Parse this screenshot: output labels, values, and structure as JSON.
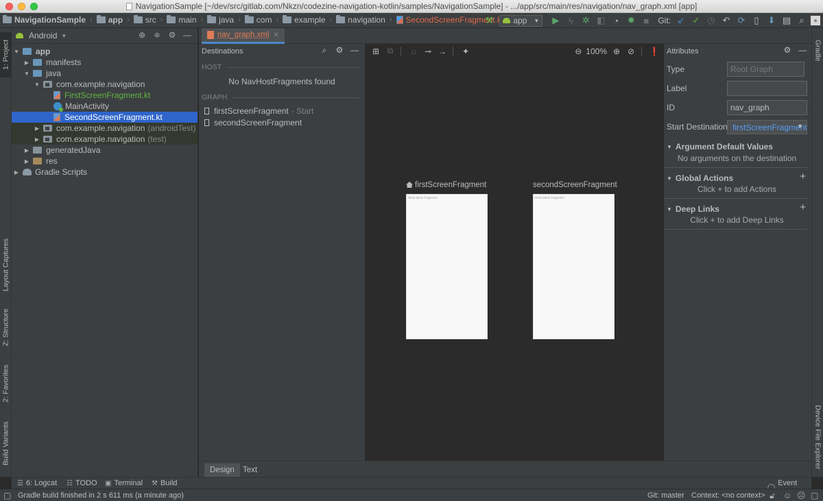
{
  "window": {
    "title": "NavigationSample [~/dev/src/gitlab.com/Nkzn/codezine-navigation-kotlin/samples/NavigationSample] - .../app/src/main/res/navigation/nav_graph.xml [app]"
  },
  "breadcrumbs": {
    "items": [
      {
        "label": "NavigationSample",
        "icon": "folder-icon"
      },
      {
        "label": "app",
        "icon": "folder-icon"
      },
      {
        "label": "src",
        "icon": "folder-icon"
      },
      {
        "label": "main",
        "icon": "folder-icon"
      },
      {
        "label": "java",
        "icon": "folder-icon"
      },
      {
        "label": "com",
        "icon": "folder-icon"
      },
      {
        "label": "example",
        "icon": "folder-icon"
      },
      {
        "label": "navigation",
        "icon": "folder-icon"
      },
      {
        "label": "SecondScreenFragment.kt",
        "icon": "kotlin-file-icon"
      }
    ]
  },
  "toolbar": {
    "run_config": "app",
    "git_label": "Git:"
  },
  "left_strip": {
    "project": "1: Project",
    "layout_captures": "Layout Captures",
    "structure": "Z: Structure",
    "favorites": "2: Favorites",
    "build_variants": "Build Variants"
  },
  "right_strip": {
    "gradle": "Gradle",
    "device_explorer": "Device File Explorer"
  },
  "project_panel": {
    "view_mode": "Android",
    "tree": [
      {
        "label": "app",
        "level": 0,
        "expanded": true
      },
      {
        "label": "manifests",
        "level": 1,
        "expanded": false
      },
      {
        "label": "java",
        "level": 1,
        "expanded": true
      },
      {
        "label": "com.example.navigation",
        "level": 2,
        "expanded": true
      },
      {
        "label": "FirstScreenFragment.kt",
        "level": 3
      },
      {
        "label": "MainActivity",
        "level": 3
      },
      {
        "label": "SecondScreenFragment.kt",
        "level": 3,
        "selected": true
      },
      {
        "label": "com.example.navigation",
        "suffix": "(androidTest)",
        "level": 2,
        "expanded": false
      },
      {
        "label": "com.example.navigation",
        "suffix": "(test)",
        "level": 2,
        "expanded": false
      },
      {
        "label": "generatedJava",
        "level": 1,
        "expanded": false
      },
      {
        "label": "res",
        "level": 1,
        "expanded": false
      },
      {
        "label": "Gradle Scripts",
        "level": 0,
        "expanded": false
      }
    ]
  },
  "editor": {
    "tab_label": "nav_graph.xml"
  },
  "destinations": {
    "header": "Destinations",
    "host_label": "HOST",
    "no_host": "No NavHostFragments found",
    "graph_label": "GRAPH",
    "items": [
      {
        "name": "firstScreenFragment",
        "sub": "- Start"
      },
      {
        "name": "secondScreenFragment",
        "sub": ""
      }
    ]
  },
  "canvas": {
    "zoom": "100%",
    "fragments": [
      {
        "label": "firstScreenFragment",
        "hint": "Hello blank fragment",
        "is_start": true
      },
      {
        "label": "secondScreenFragment",
        "hint": "Hello blank fragment",
        "is_start": false
      }
    ]
  },
  "attributes": {
    "header": "Attributes",
    "type_label": "Type",
    "type_value": "Root Graph",
    "label_label": "Label",
    "label_value": "",
    "id_label": "ID",
    "id_value": "nav_graph",
    "start_label": "Start Destination",
    "start_value": "firstScreenFragment",
    "arg_section": "Argument Default Values",
    "arg_msg": "No arguments on the destination",
    "actions_section": "Global Actions",
    "actions_msg": "Click + to add Actions",
    "links_section": "Deep Links",
    "links_msg": "Click + to add Deep Links"
  },
  "design_tabs": {
    "design": "Design",
    "text": "Text"
  },
  "tool_windows": {
    "logcat": "6: Logcat",
    "todo": "TODO",
    "terminal": "Terminal",
    "build": "Build",
    "event_log": "Event Log"
  },
  "status": {
    "message": "Gradle build finished in 2 s 611 ms (a minute ago)",
    "git_branch": "Git: master",
    "context": "Context: <no context>"
  },
  "colors": {
    "accent_selection": "#2f65ca",
    "kotlin_file": "#e07b56",
    "new_file_green": "#62b543",
    "link_blue": "#589df6"
  }
}
